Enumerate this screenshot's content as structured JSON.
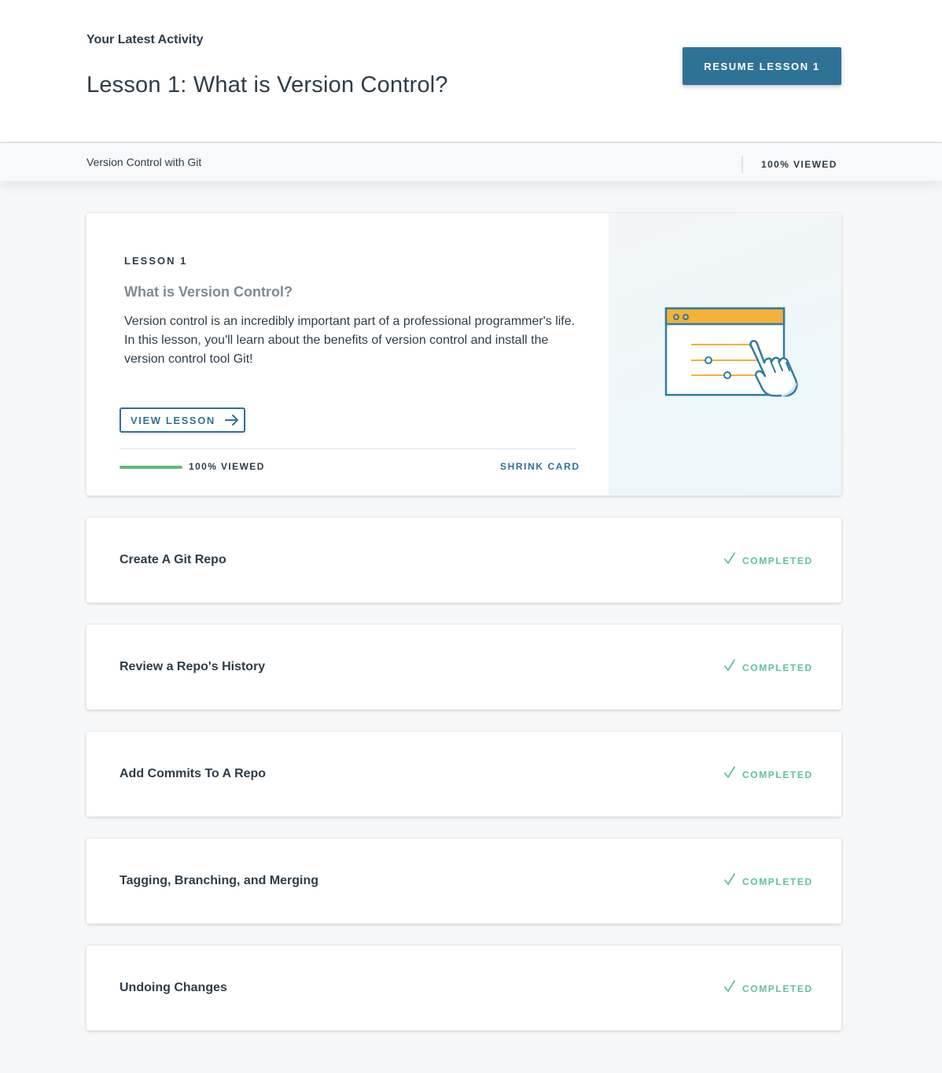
{
  "header": {
    "kicker": "Your Latest Activity",
    "title": "Lesson 1: What is Version Control?",
    "resume_label": "RESUME LESSON 1"
  },
  "subbar": {
    "course": "Version Control with Git",
    "viewed": "100% VIEWED"
  },
  "lesson_card": {
    "number_label": "LESSON 1",
    "name": "What is Version Control?",
    "description": "Version control is an incredibly important part of a professional programmer's life. In this lesson, you'll learn about the benefits of version control and install the version control tool Git!",
    "view_label": "VIEW LESSON",
    "progress_fraction": 1.0,
    "progress_text": "100% VIEWED",
    "shrink_label": "SHRINK CARD"
  },
  "concepts": [
    {
      "title": "Create A Git Repo",
      "status": "COMPLETED"
    },
    {
      "title": "Review a Repo's History",
      "status": "COMPLETED"
    },
    {
      "title": "Add Commits To A Repo",
      "status": "COMPLETED"
    },
    {
      "title": "Tagging, Branching, and Merging",
      "status": "COMPLETED"
    },
    {
      "title": "Undoing Changes",
      "status": "COMPLETED"
    }
  ],
  "icons": {
    "arrow": "arrow-right-icon",
    "check": "check-icon",
    "illustration": "browser-slider-hand-illustration"
  },
  "colors": {
    "primary": "#2e7396",
    "progress": "#5dbd74",
    "completed": "#5ec1a0",
    "illustration_orange": "#f5b13a"
  }
}
